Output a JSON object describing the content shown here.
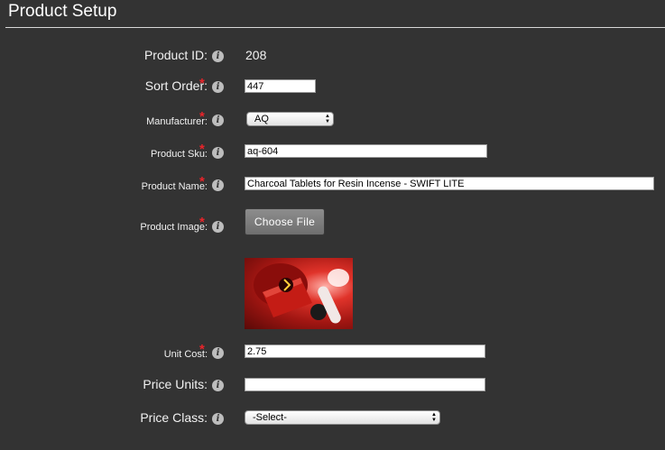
{
  "page": {
    "title": "Product Setup"
  },
  "fields": {
    "product_id": {
      "label": "Product ID:",
      "value": "208"
    },
    "sort_order": {
      "label": "Sort Order:",
      "value": "447"
    },
    "manufacturer": {
      "label": "Manufacturer:",
      "selected": "AQ"
    },
    "product_sku": {
      "label": "Product Sku:",
      "value": "aq-604"
    },
    "product_name": {
      "label": "Product Name:",
      "value": "Charcoal Tablets for Resin Incense - SWIFT LITE"
    },
    "product_image": {
      "label": "Product Image:",
      "button_label": "Choose File"
    },
    "unit_cost": {
      "label": "Unit Cost:",
      "value": "2.75"
    },
    "price_units": {
      "label": "Price Units:",
      "value": ""
    },
    "price_class": {
      "label": "Price Class:",
      "selected": "-Select-"
    }
  },
  "markers": {
    "required": "*",
    "info": "i"
  },
  "colors": {
    "background": "#333333",
    "required": "#e8242a",
    "info_icon": "#bdbdbd"
  }
}
